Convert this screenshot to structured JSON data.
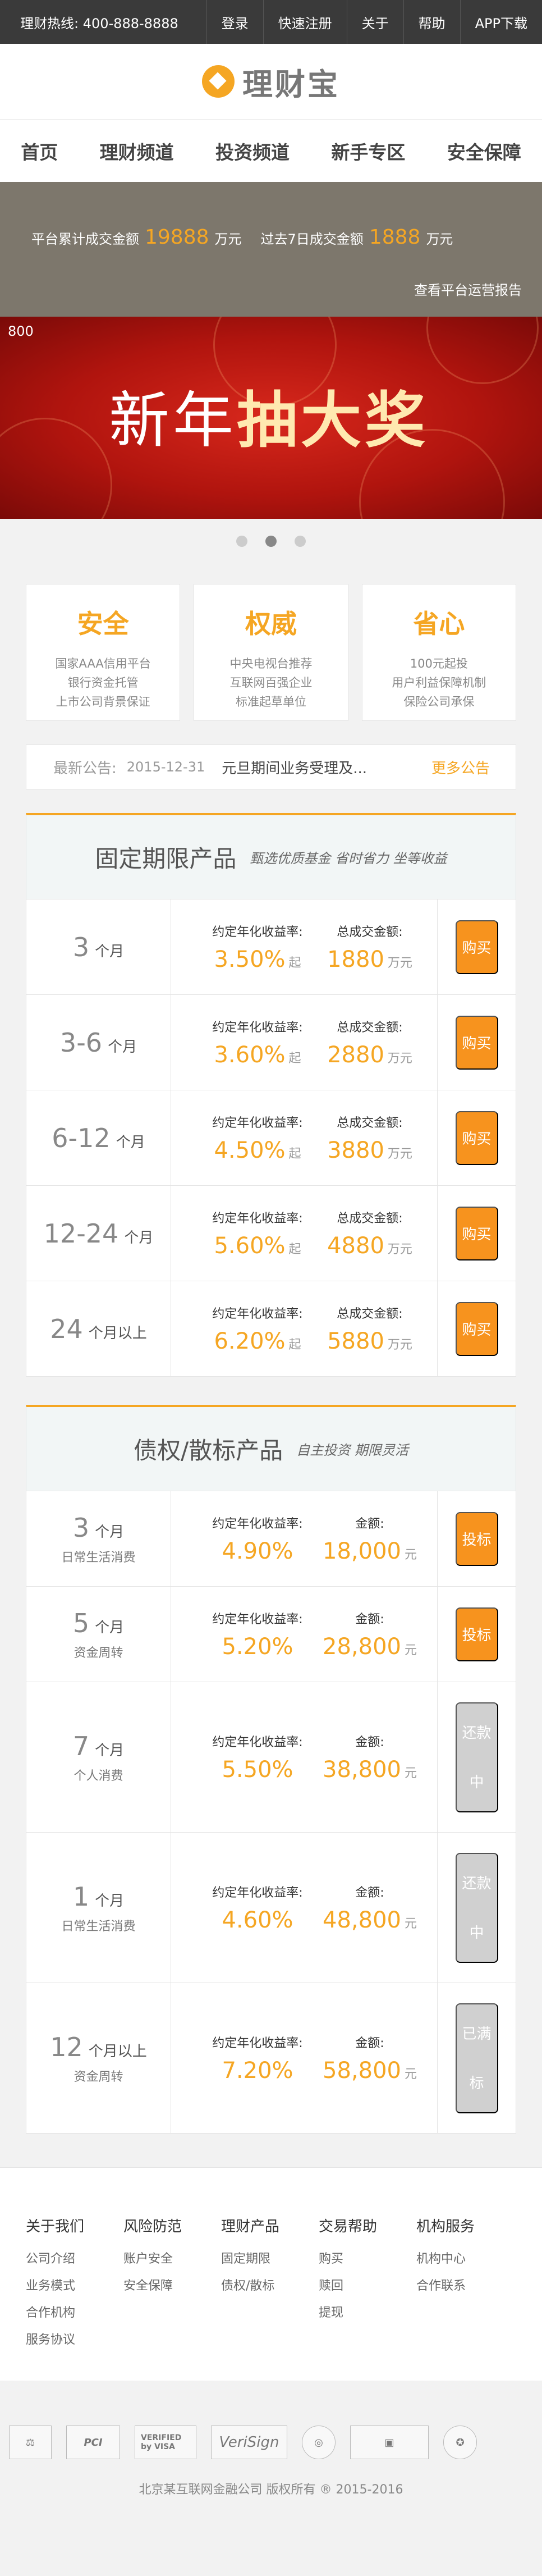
{
  "topbar": {
    "hotline": "理财热线: 400-888-8888",
    "links": [
      "登录",
      "快速注册",
      "关于",
      "帮助",
      "APP下载"
    ]
  },
  "logo": {
    "text": "理财宝",
    "icon": "diamond-coin-icon",
    "color": "#f5a623"
  },
  "nav": [
    "首页",
    "理财频道",
    "投资频道",
    "新手专区",
    "安全保障"
  ],
  "stats": {
    "total_label": "平台累计成交金额",
    "total_value": "19888",
    "total_unit": "万元",
    "week_label": "过去7日成交金额",
    "week_value": "1888",
    "week_unit": "万元",
    "report_link": "查看平台运营报告"
  },
  "banner": {
    "index": "800",
    "title_normal": "新年",
    "title_bold": "抽大奖",
    "dots": 3,
    "active_dot": 1
  },
  "features": [
    {
      "title": "安全",
      "lines": [
        "国家AAA信用平台",
        "银行资金托管",
        "上市公司背景保证"
      ]
    },
    {
      "title": "权威",
      "lines": [
        "中央电视台推荐",
        "互联网百强企业",
        "标准起草单位"
      ]
    },
    {
      "title": "省心",
      "lines": [
        "100元起投",
        "用户利益保障机制",
        "保险公司承保"
      ]
    }
  ],
  "notice": {
    "label": "最新公告:",
    "date": "2015-12-31",
    "text": "元旦期间业务受理及...",
    "more": "更多公告"
  },
  "fixed_section": {
    "title": "固定期限产品",
    "subtitle": "甄选优质基金 省时省力 坐等收益",
    "rate_label": "约定年化收益率:",
    "amount_label": "总成交金额:",
    "rate_suffix": "起",
    "amount_suffix": "万元",
    "products": [
      {
        "term": "3",
        "unit": "个月",
        "rate": "3.50%",
        "amount": "1880",
        "action": "购买"
      },
      {
        "term": "3-6",
        "unit": "个月",
        "rate": "3.60%",
        "amount": "2880",
        "action": "购买"
      },
      {
        "term": "6-12",
        "unit": "个月",
        "rate": "4.50%",
        "amount": "3880",
        "action": "购买"
      },
      {
        "term": "12-24",
        "unit": "个月",
        "rate": "5.60%",
        "amount": "4880",
        "action": "购买"
      },
      {
        "term": "24",
        "unit": "个月以上",
        "rate": "6.20%",
        "amount": "5880",
        "action": "购买"
      }
    ]
  },
  "debt_section": {
    "title": "债权/散标产品",
    "subtitle": "自主投资 期限灵活",
    "rate_label": "约定年化收益率:",
    "amount_label": "金额:",
    "amount_suffix": "元",
    "products": [
      {
        "term": "3",
        "unit": "个月",
        "desc": "日常生活消费",
        "rate": "4.90%",
        "amount": "18,000",
        "action": "投标",
        "status": "active"
      },
      {
        "term": "5",
        "unit": "个月",
        "desc": "资金周转",
        "rate": "5.20%",
        "amount": "28,800",
        "action": "投标",
        "status": "active"
      },
      {
        "term": "7",
        "unit": "个月",
        "desc": "个人消费",
        "rate": "5.50%",
        "amount": "38,800",
        "action": "还款中",
        "status": "disabled"
      },
      {
        "term": "1",
        "unit": "个月",
        "desc": "日常生活消费",
        "rate": "4.60%",
        "amount": "48,800",
        "action": "还款中",
        "status": "disabled"
      },
      {
        "term": "12",
        "unit": "个月以上",
        "desc": "资金周转",
        "rate": "7.20%",
        "amount": "58,800",
        "action": "已满标",
        "status": "disabled"
      }
    ]
  },
  "footer": {
    "columns": [
      {
        "title": "关于我们",
        "items": [
          "公司介绍",
          "业务模式",
          "合作机构",
          "服务协议"
        ]
      },
      {
        "title": "风险防范",
        "items": [
          "账户安全",
          "安全保障"
        ]
      },
      {
        "title": "理财产品",
        "items": [
          "固定期限",
          "债权/散标"
        ]
      },
      {
        "title": "交易帮助",
        "items": [
          "购买",
          "赎回",
          "提现"
        ]
      },
      {
        "title": "机构服务",
        "items": [
          "机构中心",
          "合作联系"
        ]
      }
    ],
    "certs": [
      "PCI",
      "VERIFIED by VISA",
      "VeriSign"
    ],
    "copyright": "北京某互联网金融公司 版权所有 ® 2015-2016"
  }
}
